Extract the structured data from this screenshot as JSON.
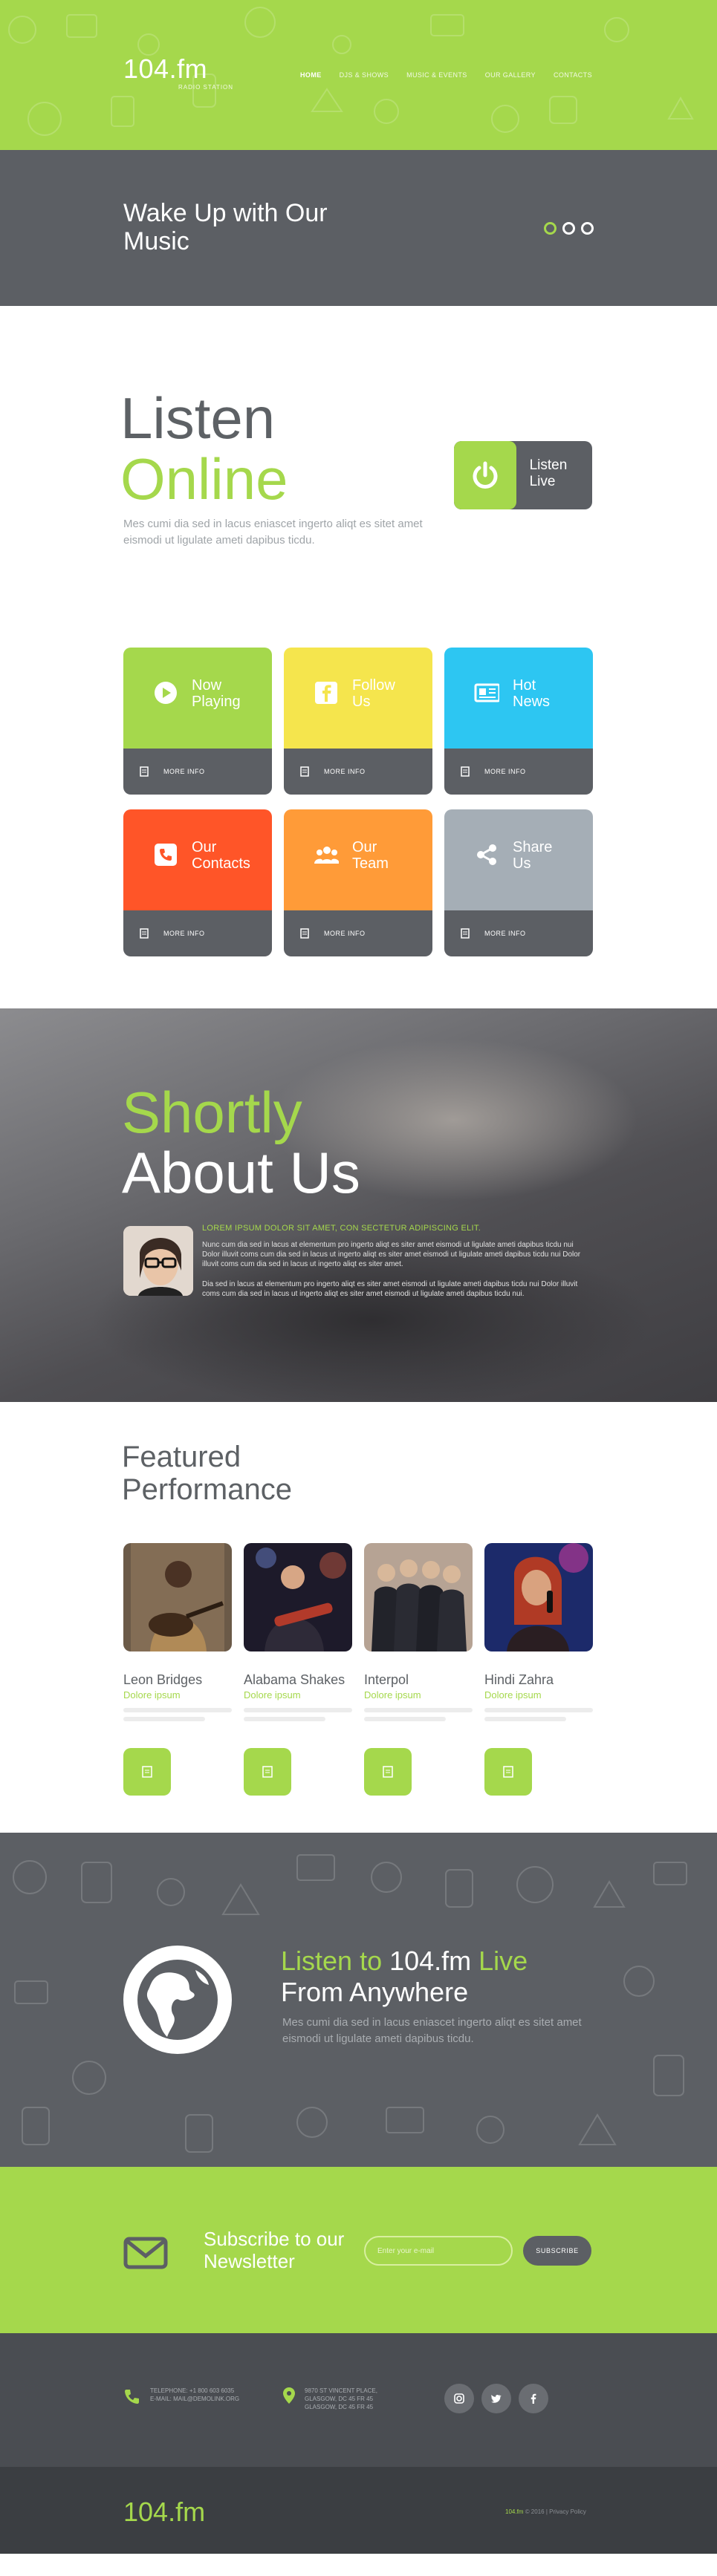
{
  "header": {
    "logo": "104.fm",
    "tagline": "RADIO STATION",
    "nav": [
      "HOME",
      "DJS & SHOWS",
      "MUSIC & EVENTS",
      "OUR GALLERY",
      "CONTACTS"
    ]
  },
  "slider": {
    "title": "Wake Up with Our Music"
  },
  "listen": {
    "heading1": "Listen",
    "heading2": "Online",
    "description": "Mes cumi dia sed in lacus eniascet ingerto aliqt es sitet amet eismodi ut ligulate ameti dapibus ticdu.",
    "button_label": "Listen Live"
  },
  "tiles": [
    {
      "label": "Now Playing",
      "color": "#a5d84c",
      "more": "MORE INFO",
      "icon": "play-icon"
    },
    {
      "label": "Follow Us",
      "color": "#f5e54d",
      "more": "MORE INFO",
      "icon": "facebook-icon"
    },
    {
      "label": "Hot News",
      "color": "#2dc6f2",
      "more": "MORE INFO",
      "icon": "newspaper-icon"
    },
    {
      "label": "Our Contacts",
      "color": "#ff5528",
      "more": "MORE INFO",
      "icon": "phone-icon"
    },
    {
      "label": "Our Team",
      "color": "#ff9b38",
      "more": "MORE INFO",
      "icon": "team-icon"
    },
    {
      "label": "Share Us",
      "color": "#a5aeb6",
      "more": "MORE INFO",
      "icon": "share-icon"
    }
  ],
  "about": {
    "title1": "Shortly",
    "title2": "About Us",
    "subtitle": "LOREM IPSUM DOLOR SIT AMET, CON SECTETUR ADIPISCING ELIT.",
    "p1": "Nunc cum dia sed in lacus at elementum pro ingerto aliqt es siter amet eismodi ut ligulate ameti dapibus ticdu nui Dolor illuvit coms cum dia sed in lacus ut ingerto aliqt es siter amet eismodi ut ligulate ameti dapibus ticdu nui Dolor illuvit coms cum dia sed in lacus ut ingerto aliqt es siter amet.",
    "p2": "Dia sed in lacus at elementum pro ingerto aliqt es siter amet eismodi ut ligulate ameti dapibus ticdu nui Dolor illuvit coms cum dia sed in lacus ut ingerto aliqt es siter amet eismodi ut ligulate ameti dapibus ticdu nui."
  },
  "featured": {
    "title": "Featured Performance",
    "items": [
      {
        "name": "Leon Bridges",
        "genre": "Dolore ipsum"
      },
      {
        "name": "Alabama Shakes",
        "genre": "Dolore ipsum"
      },
      {
        "name": "Interpol",
        "genre": "Dolore ipsum"
      },
      {
        "name": "Hindi Zahra",
        "genre": "Dolore ipsum"
      }
    ]
  },
  "anywhere": {
    "t_a": "Listen to ",
    "t_b": "104.fm",
    "t_c": " Live",
    "t_line2": "From Anywhere",
    "description": "Mes cumi dia sed in lacus eniascet ingerto aliqt es sitet amet eismodi ut ligulate ameti dapibus ticdu."
  },
  "newsletter": {
    "title": "Subscribe to our Newsletter",
    "placeholder": "Enter your e-mail",
    "button": "SUBSCRIBE"
  },
  "footer": {
    "phone1": "TELEPHONE: +1 800 603 6035",
    "phone2": "E-MAIL: MAIL@DEMOLINK.ORG",
    "addr1": "9870 ST VINCENT PLACE,",
    "addr2": "GLASGOW, DC 45 FR 45",
    "addr3": "GLASGOW, DC 45 FR 45",
    "social": [
      "instagram-icon",
      "twitter-icon",
      "facebook-icon"
    ],
    "logo": "104.fm",
    "copyright_brand": "104.fm",
    "copyright_rest": " © 2016 | Privacy Policy"
  },
  "colors": {
    "accent": "#a5d84c",
    "dark": "#5c5f64"
  }
}
